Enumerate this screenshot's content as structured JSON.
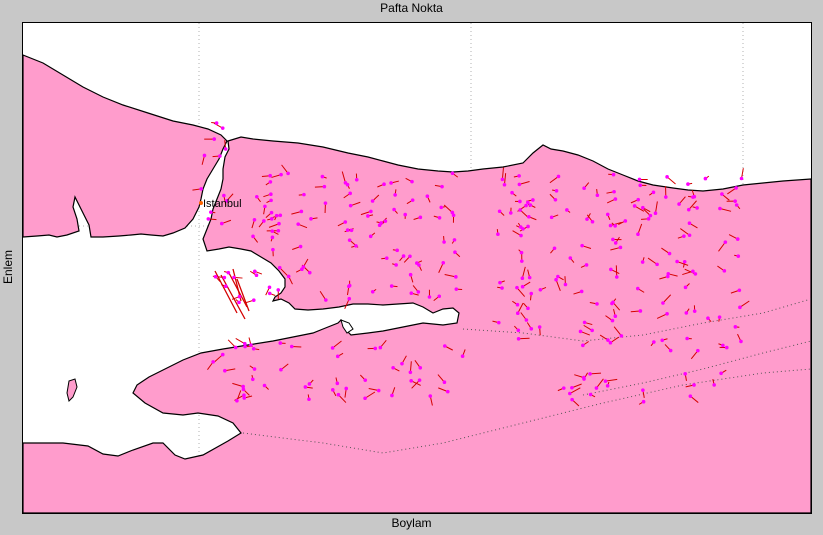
{
  "title": "Pafta Nokta",
  "xlabel": "Boylam",
  "ylabel": "Enlem",
  "city_label": "Istanbul",
  "colors": {
    "background": "#c8c8c8",
    "land": "#ff9ccc",
    "sea": "#ffffff",
    "coastline": "#000000",
    "point": "#ff00ff",
    "vector": "#d40000"
  }
}
